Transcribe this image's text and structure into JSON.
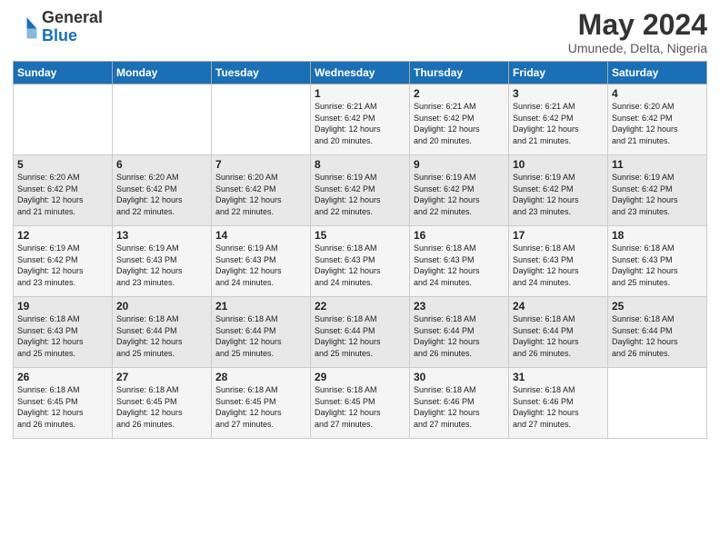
{
  "logo": {
    "line1": "General",
    "line2": "Blue"
  },
  "title": "May 2024",
  "location": "Umunede, Delta, Nigeria",
  "days_of_week": [
    "Sunday",
    "Monday",
    "Tuesday",
    "Wednesday",
    "Thursday",
    "Friday",
    "Saturday"
  ],
  "weeks": [
    [
      {
        "num": "",
        "info": ""
      },
      {
        "num": "",
        "info": ""
      },
      {
        "num": "",
        "info": ""
      },
      {
        "num": "1",
        "info": "Sunrise: 6:21 AM\nSunset: 6:42 PM\nDaylight: 12 hours\nand 20 minutes."
      },
      {
        "num": "2",
        "info": "Sunrise: 6:21 AM\nSunset: 6:42 PM\nDaylight: 12 hours\nand 20 minutes."
      },
      {
        "num": "3",
        "info": "Sunrise: 6:21 AM\nSunset: 6:42 PM\nDaylight: 12 hours\nand 21 minutes."
      },
      {
        "num": "4",
        "info": "Sunrise: 6:20 AM\nSunset: 6:42 PM\nDaylight: 12 hours\nand 21 minutes."
      }
    ],
    [
      {
        "num": "5",
        "info": "Sunrise: 6:20 AM\nSunset: 6:42 PM\nDaylight: 12 hours\nand 21 minutes."
      },
      {
        "num": "6",
        "info": "Sunrise: 6:20 AM\nSunset: 6:42 PM\nDaylight: 12 hours\nand 22 minutes."
      },
      {
        "num": "7",
        "info": "Sunrise: 6:20 AM\nSunset: 6:42 PM\nDaylight: 12 hours\nand 22 minutes."
      },
      {
        "num": "8",
        "info": "Sunrise: 6:19 AM\nSunset: 6:42 PM\nDaylight: 12 hours\nand 22 minutes."
      },
      {
        "num": "9",
        "info": "Sunrise: 6:19 AM\nSunset: 6:42 PM\nDaylight: 12 hours\nand 22 minutes."
      },
      {
        "num": "10",
        "info": "Sunrise: 6:19 AM\nSunset: 6:42 PM\nDaylight: 12 hours\nand 23 minutes."
      },
      {
        "num": "11",
        "info": "Sunrise: 6:19 AM\nSunset: 6:42 PM\nDaylight: 12 hours\nand 23 minutes."
      }
    ],
    [
      {
        "num": "12",
        "info": "Sunrise: 6:19 AM\nSunset: 6:42 PM\nDaylight: 12 hours\nand 23 minutes."
      },
      {
        "num": "13",
        "info": "Sunrise: 6:19 AM\nSunset: 6:43 PM\nDaylight: 12 hours\nand 23 minutes."
      },
      {
        "num": "14",
        "info": "Sunrise: 6:19 AM\nSunset: 6:43 PM\nDaylight: 12 hours\nand 24 minutes."
      },
      {
        "num": "15",
        "info": "Sunrise: 6:18 AM\nSunset: 6:43 PM\nDaylight: 12 hours\nand 24 minutes."
      },
      {
        "num": "16",
        "info": "Sunrise: 6:18 AM\nSunset: 6:43 PM\nDaylight: 12 hours\nand 24 minutes."
      },
      {
        "num": "17",
        "info": "Sunrise: 6:18 AM\nSunset: 6:43 PM\nDaylight: 12 hours\nand 24 minutes."
      },
      {
        "num": "18",
        "info": "Sunrise: 6:18 AM\nSunset: 6:43 PM\nDaylight: 12 hours\nand 25 minutes."
      }
    ],
    [
      {
        "num": "19",
        "info": "Sunrise: 6:18 AM\nSunset: 6:43 PM\nDaylight: 12 hours\nand 25 minutes."
      },
      {
        "num": "20",
        "info": "Sunrise: 6:18 AM\nSunset: 6:44 PM\nDaylight: 12 hours\nand 25 minutes."
      },
      {
        "num": "21",
        "info": "Sunrise: 6:18 AM\nSunset: 6:44 PM\nDaylight: 12 hours\nand 25 minutes."
      },
      {
        "num": "22",
        "info": "Sunrise: 6:18 AM\nSunset: 6:44 PM\nDaylight: 12 hours\nand 25 minutes."
      },
      {
        "num": "23",
        "info": "Sunrise: 6:18 AM\nSunset: 6:44 PM\nDaylight: 12 hours\nand 26 minutes."
      },
      {
        "num": "24",
        "info": "Sunrise: 6:18 AM\nSunset: 6:44 PM\nDaylight: 12 hours\nand 26 minutes."
      },
      {
        "num": "25",
        "info": "Sunrise: 6:18 AM\nSunset: 6:44 PM\nDaylight: 12 hours\nand 26 minutes."
      }
    ],
    [
      {
        "num": "26",
        "info": "Sunrise: 6:18 AM\nSunset: 6:45 PM\nDaylight: 12 hours\nand 26 minutes."
      },
      {
        "num": "27",
        "info": "Sunrise: 6:18 AM\nSunset: 6:45 PM\nDaylight: 12 hours\nand 26 minutes."
      },
      {
        "num": "28",
        "info": "Sunrise: 6:18 AM\nSunset: 6:45 PM\nDaylight: 12 hours\nand 27 minutes."
      },
      {
        "num": "29",
        "info": "Sunrise: 6:18 AM\nSunset: 6:45 PM\nDaylight: 12 hours\nand 27 minutes."
      },
      {
        "num": "30",
        "info": "Sunrise: 6:18 AM\nSunset: 6:46 PM\nDaylight: 12 hours\nand 27 minutes."
      },
      {
        "num": "31",
        "info": "Sunrise: 6:18 AM\nSunset: 6:46 PM\nDaylight: 12 hours\nand 27 minutes."
      },
      {
        "num": "",
        "info": ""
      }
    ]
  ]
}
